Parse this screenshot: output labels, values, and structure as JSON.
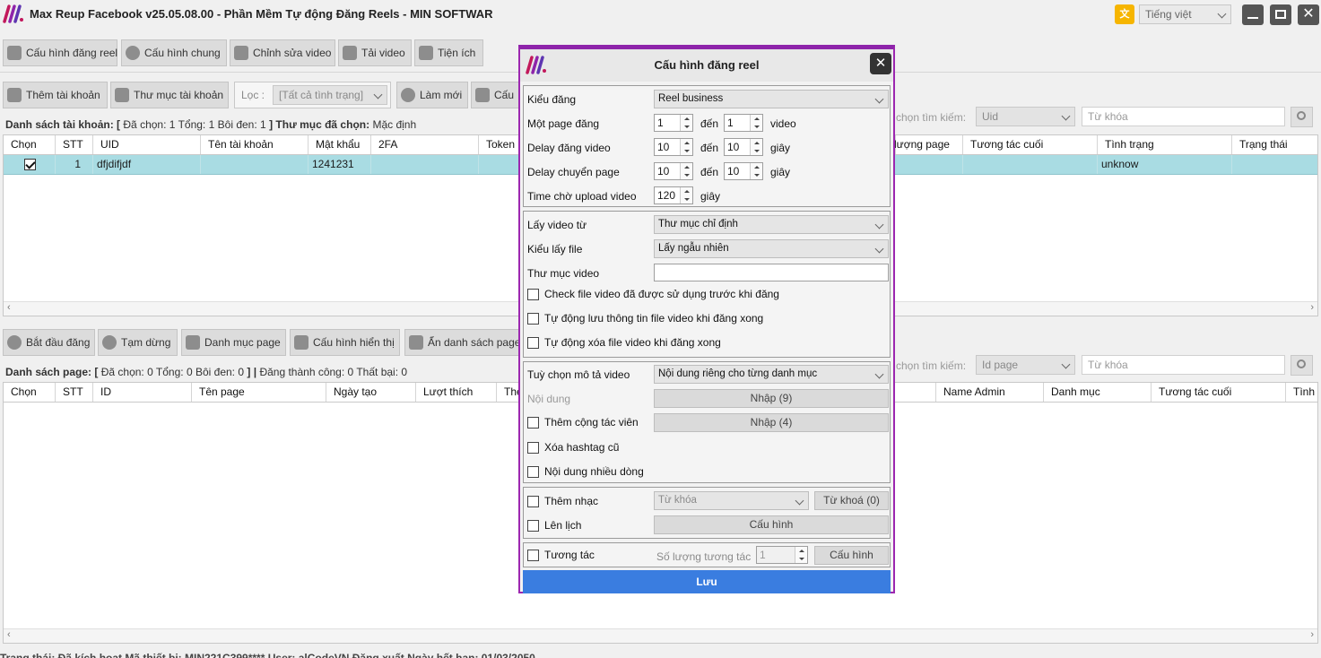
{
  "window": {
    "title": "Max Reup Facebook v25.05.08.00 - Phần Mềm Tự động Đăng Reels - MIN SOFTWAR",
    "language": "Tiếng việt"
  },
  "main_toolbar": [
    "Cấu hình đăng reel",
    "Cấu hình chung",
    "Chỉnh sửa video",
    "Tải video",
    "Tiện ích"
  ],
  "account_toolbar": {
    "add_account": "Thêm tài khoản",
    "account_folder": "Thư mục tài khoản",
    "filter_label": "Lọc :",
    "filter_value": "[Tất cả tình trạng]",
    "refresh": "Làm mới",
    "config": "Cấu"
  },
  "account_info": {
    "list_label": "Danh sách tài khoản:",
    "open": "[",
    "selected_label": "Đã chọn:",
    "selected": "1",
    "total_label": "Tổng:",
    "total": "1",
    "highlight_label": "Bôi đen:",
    "highlight": "1",
    "close": "]",
    "folder_label": "Thư mục đã chọn:",
    "folder": "Mặc định"
  },
  "account_search": {
    "label": "chọn tìm kiếm:",
    "field": "Uid",
    "placeholder": "Từ khóa"
  },
  "account_columns": [
    "Chọn",
    "STT",
    "UID",
    "Tên tài khoản",
    "Mật khẩu",
    "2FA",
    "Token",
    "lượng page",
    "Tương tác cuối",
    "Tình trạng",
    "Trạng thái"
  ],
  "account_rows": [
    {
      "stt": "1",
      "uid": "dfjdifjdf",
      "name": "",
      "password": "1241231",
      "fa2": "",
      "token": "",
      "pages": "",
      "last": "",
      "status": "unknow",
      "state": ""
    }
  ],
  "page_toolbar": {
    "start": "Bắt đầu đăng",
    "pause": "Tạm dừng",
    "categories": "Danh mục page",
    "display": "Cấu hình hiển thị",
    "hide_pages": "Ẩn danh sách page"
  },
  "page_info": {
    "list_label": "Danh sách page:",
    "open": "[",
    "selected_label": "Đã chọn:",
    "selected": "0",
    "total_label": "Tổng:",
    "total": "0",
    "highlight_label": "Bôi đen:",
    "highlight": "0",
    "close": "]",
    "sep": "|",
    "success_label": "Đăng thành công:",
    "success": "0",
    "fail_label": "Thất bại:",
    "fail": "0"
  },
  "page_search": {
    "label": "chọn tìm kiếm:",
    "field": "Id page",
    "placeholder": "Từ khóa"
  },
  "page_columns": [
    "Chọn",
    "STT",
    "ID",
    "Tên page",
    "Ngày tạo",
    "Lượt thích",
    "The",
    "Name Admin",
    "Danh mục",
    "Tương tác cuối",
    "Tình"
  ],
  "status_bar": "Trạng thái:  Đã kích hoạt   Mã thiết bị:  MIN221C399****   User:  alCodeVN   Đăng xuất   Ngày hết hạn:  01/03/2050",
  "dialog": {
    "title": "Cấu hình đăng reel",
    "post_type_label": "Kiểu đăng",
    "post_type": "Reel business",
    "per_page_label": "Một page đăng",
    "per_page_from": "1",
    "per_page_to": "1",
    "to": "đến",
    "video_unit": "video",
    "delay_video_label": "Delay đăng video",
    "delay_video_from": "10",
    "delay_video_to": "10",
    "delay_page_label": "Delay chuyển page",
    "delay_page_from": "10",
    "delay_page_to": "10",
    "seconds": "giây",
    "upload_wait_label": "Time chờ upload video",
    "upload_wait": "120",
    "source_label": "Lấy video từ",
    "source": "Thư mục chỉ định",
    "file_mode_label": "Kiểu lấy file",
    "file_mode": "Lấy ngẫu nhiên",
    "folder_label": "Thư mục video",
    "folder": "",
    "check_used": "Check file video đã được sử dụng trước khi đăng",
    "auto_save": "Tự động lưu thông tin file video khi đăng xong",
    "auto_delete": "Tự động xóa file video khi đăng xong",
    "desc_label": "Tuỳ chọn mô tả video",
    "desc_option": "Nội dung riêng cho từng danh mục",
    "content_label": "Nội dung",
    "content_btn": "Nhập (9)",
    "collab": "Thêm cộng tác viên",
    "collab_btn": "Nhập (4)",
    "remove_hashtag": "Xóa hashtag cũ",
    "multiline": "Nội dung nhiều dòng",
    "music": "Thêm nhạc",
    "music_keyword": "Từ khóa",
    "music_btn": "Từ khoá (0)",
    "schedule": "Lên lịch",
    "schedule_btn": "Cấu hình",
    "interact": "Tương tác",
    "interact_count_label": "Số lượng tương tác",
    "interact_count": "1",
    "interact_btn": "Cấu hình",
    "save": "Lưu"
  },
  "colors": {
    "accent": "#8e24aa",
    "save_button": "#3a7de0",
    "selected_row": "#a9dce3"
  }
}
